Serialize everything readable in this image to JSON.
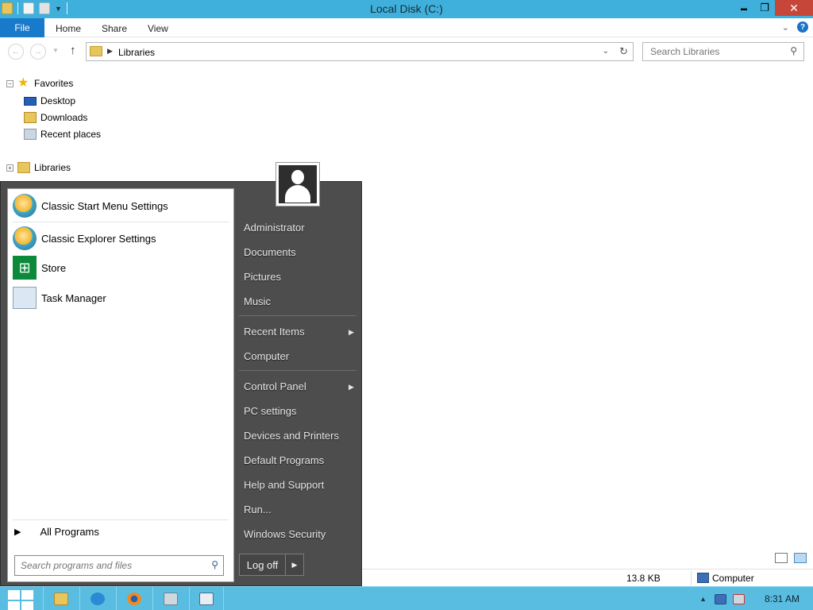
{
  "window": {
    "title": "Local Disk (C:)",
    "min_glyph": "▬",
    "max_glyph": "❐",
    "close_glyph": "✕"
  },
  "ribbon": {
    "file": "File",
    "tabs": [
      "Home",
      "Share",
      "View"
    ],
    "help": "?"
  },
  "address": {
    "crumb": "Libraries",
    "search_placeholder": "Search Libraries"
  },
  "navpane": {
    "favorites": "Favorites",
    "items": [
      "Desktop",
      "Downloads",
      "Recent places"
    ],
    "libraries": "Libraries"
  },
  "startmenu": {
    "pinned": [
      "Classic Start Menu Settings",
      "Classic Explorer Settings",
      "Store",
      "Task Manager"
    ],
    "all_programs": "All Programs",
    "search_placeholder": "Search programs and files",
    "right_items": [
      "Administrator",
      "Documents",
      "Pictures",
      "Music",
      "Recent Items",
      "Computer",
      "Control Panel",
      "PC settings",
      "Devices and Printers",
      "Default Programs",
      "Help and Support",
      "Run...",
      "Windows Security"
    ],
    "log_off": "Log off"
  },
  "statusbar": {
    "size": "13.8 KB",
    "location": "Computer"
  },
  "taskbar": {
    "clock": "8:31 AM"
  },
  "colors": {
    "titlebar": "#3fb0dc",
    "file_tab": "#1979ca",
    "close": "#c7463a",
    "startmenu_bg": "#4d4d4d",
    "taskbar": "#59bde2"
  }
}
